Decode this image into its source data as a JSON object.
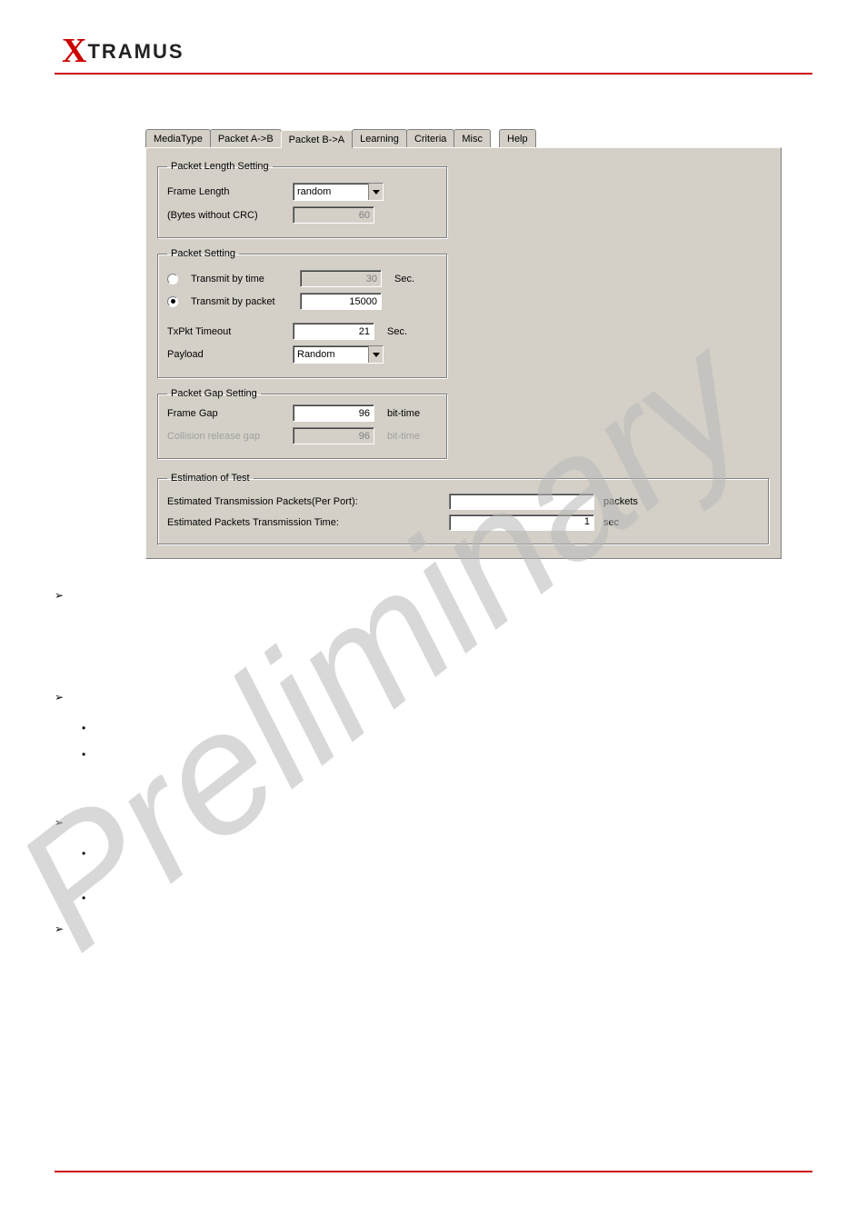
{
  "logo": {
    "x": "X",
    "rest": "TRAMUS"
  },
  "tabs": {
    "mediaType": "MediaType",
    "packetAB": "Packet A->B",
    "packetBA": "Packet B->A",
    "learning": "Learning",
    "criteria": "Criteria",
    "misc": "Misc",
    "help": "Help"
  },
  "packetLengthSetting": {
    "legend": "Packet Length Setting",
    "frameLengthLabel": "Frame Length",
    "frameLengthValue": "random",
    "bytesLabel": "(Bytes without CRC)",
    "bytesValue": "60"
  },
  "packetSetting": {
    "legend": "Packet Setting",
    "transmitByTime": "Transmit by time",
    "transmitByTimeValue": "30",
    "transmitByTimeUnit": "Sec.",
    "transmitByPacket": "Transmit by packet",
    "transmitByPacketValue": "15000",
    "txPktTimeoutLabel": "TxPkt Timeout",
    "txPktTimeoutValue": "21",
    "txPktTimeoutUnit": "Sec.",
    "payloadLabel": "Payload",
    "payloadValue": "Random"
  },
  "packetGapSetting": {
    "legend": "Packet Gap Setting",
    "frameGapLabel": "Frame Gap",
    "frameGapValue": "96",
    "frameGapUnit": "bit-time",
    "collisionLabel": "Collision release gap",
    "collisionValue": "96",
    "collisionUnit": "bit-time"
  },
  "estimation": {
    "legend": "Estimation of Test",
    "packetsLabel": "Estimated Transmission Packets(Per Port):",
    "packetsValue": "",
    "packetsUnit": "packets",
    "timeLabel": "Estimated Packets Transmission Time:",
    "timeValue": "1",
    "timeUnit": "sec"
  }
}
